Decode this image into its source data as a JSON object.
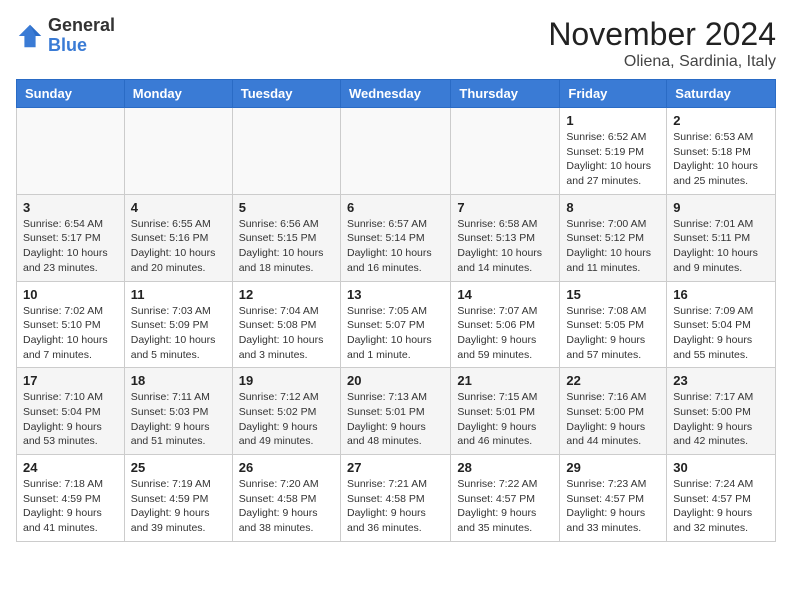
{
  "header": {
    "logo_general": "General",
    "logo_blue": "Blue",
    "month_title": "November 2024",
    "location": "Oliena, Sardinia, Italy"
  },
  "weekdays": [
    "Sunday",
    "Monday",
    "Tuesday",
    "Wednesday",
    "Thursday",
    "Friday",
    "Saturday"
  ],
  "weeks": [
    [
      {
        "day": "",
        "info": ""
      },
      {
        "day": "",
        "info": ""
      },
      {
        "day": "",
        "info": ""
      },
      {
        "day": "",
        "info": ""
      },
      {
        "day": "",
        "info": ""
      },
      {
        "day": "1",
        "info": "Sunrise: 6:52 AM\nSunset: 5:19 PM\nDaylight: 10 hours and 27 minutes."
      },
      {
        "day": "2",
        "info": "Sunrise: 6:53 AM\nSunset: 5:18 PM\nDaylight: 10 hours and 25 minutes."
      }
    ],
    [
      {
        "day": "3",
        "info": "Sunrise: 6:54 AM\nSunset: 5:17 PM\nDaylight: 10 hours and 23 minutes."
      },
      {
        "day": "4",
        "info": "Sunrise: 6:55 AM\nSunset: 5:16 PM\nDaylight: 10 hours and 20 minutes."
      },
      {
        "day": "5",
        "info": "Sunrise: 6:56 AM\nSunset: 5:15 PM\nDaylight: 10 hours and 18 minutes."
      },
      {
        "day": "6",
        "info": "Sunrise: 6:57 AM\nSunset: 5:14 PM\nDaylight: 10 hours and 16 minutes."
      },
      {
        "day": "7",
        "info": "Sunrise: 6:58 AM\nSunset: 5:13 PM\nDaylight: 10 hours and 14 minutes."
      },
      {
        "day": "8",
        "info": "Sunrise: 7:00 AM\nSunset: 5:12 PM\nDaylight: 10 hours and 11 minutes."
      },
      {
        "day": "9",
        "info": "Sunrise: 7:01 AM\nSunset: 5:11 PM\nDaylight: 10 hours and 9 minutes."
      }
    ],
    [
      {
        "day": "10",
        "info": "Sunrise: 7:02 AM\nSunset: 5:10 PM\nDaylight: 10 hours and 7 minutes."
      },
      {
        "day": "11",
        "info": "Sunrise: 7:03 AM\nSunset: 5:09 PM\nDaylight: 10 hours and 5 minutes."
      },
      {
        "day": "12",
        "info": "Sunrise: 7:04 AM\nSunset: 5:08 PM\nDaylight: 10 hours and 3 minutes."
      },
      {
        "day": "13",
        "info": "Sunrise: 7:05 AM\nSunset: 5:07 PM\nDaylight: 10 hours and 1 minute."
      },
      {
        "day": "14",
        "info": "Sunrise: 7:07 AM\nSunset: 5:06 PM\nDaylight: 9 hours and 59 minutes."
      },
      {
        "day": "15",
        "info": "Sunrise: 7:08 AM\nSunset: 5:05 PM\nDaylight: 9 hours and 57 minutes."
      },
      {
        "day": "16",
        "info": "Sunrise: 7:09 AM\nSunset: 5:04 PM\nDaylight: 9 hours and 55 minutes."
      }
    ],
    [
      {
        "day": "17",
        "info": "Sunrise: 7:10 AM\nSunset: 5:04 PM\nDaylight: 9 hours and 53 minutes."
      },
      {
        "day": "18",
        "info": "Sunrise: 7:11 AM\nSunset: 5:03 PM\nDaylight: 9 hours and 51 minutes."
      },
      {
        "day": "19",
        "info": "Sunrise: 7:12 AM\nSunset: 5:02 PM\nDaylight: 9 hours and 49 minutes."
      },
      {
        "day": "20",
        "info": "Sunrise: 7:13 AM\nSunset: 5:01 PM\nDaylight: 9 hours and 48 minutes."
      },
      {
        "day": "21",
        "info": "Sunrise: 7:15 AM\nSunset: 5:01 PM\nDaylight: 9 hours and 46 minutes."
      },
      {
        "day": "22",
        "info": "Sunrise: 7:16 AM\nSunset: 5:00 PM\nDaylight: 9 hours and 44 minutes."
      },
      {
        "day": "23",
        "info": "Sunrise: 7:17 AM\nSunset: 5:00 PM\nDaylight: 9 hours and 42 minutes."
      }
    ],
    [
      {
        "day": "24",
        "info": "Sunrise: 7:18 AM\nSunset: 4:59 PM\nDaylight: 9 hours and 41 minutes."
      },
      {
        "day": "25",
        "info": "Sunrise: 7:19 AM\nSunset: 4:59 PM\nDaylight: 9 hours and 39 minutes."
      },
      {
        "day": "26",
        "info": "Sunrise: 7:20 AM\nSunset: 4:58 PM\nDaylight: 9 hours and 38 minutes."
      },
      {
        "day": "27",
        "info": "Sunrise: 7:21 AM\nSunset: 4:58 PM\nDaylight: 9 hours and 36 minutes."
      },
      {
        "day": "28",
        "info": "Sunrise: 7:22 AM\nSunset: 4:57 PM\nDaylight: 9 hours and 35 minutes."
      },
      {
        "day": "29",
        "info": "Sunrise: 7:23 AM\nSunset: 4:57 PM\nDaylight: 9 hours and 33 minutes."
      },
      {
        "day": "30",
        "info": "Sunrise: 7:24 AM\nSunset: 4:57 PM\nDaylight: 9 hours and 32 minutes."
      }
    ]
  ]
}
